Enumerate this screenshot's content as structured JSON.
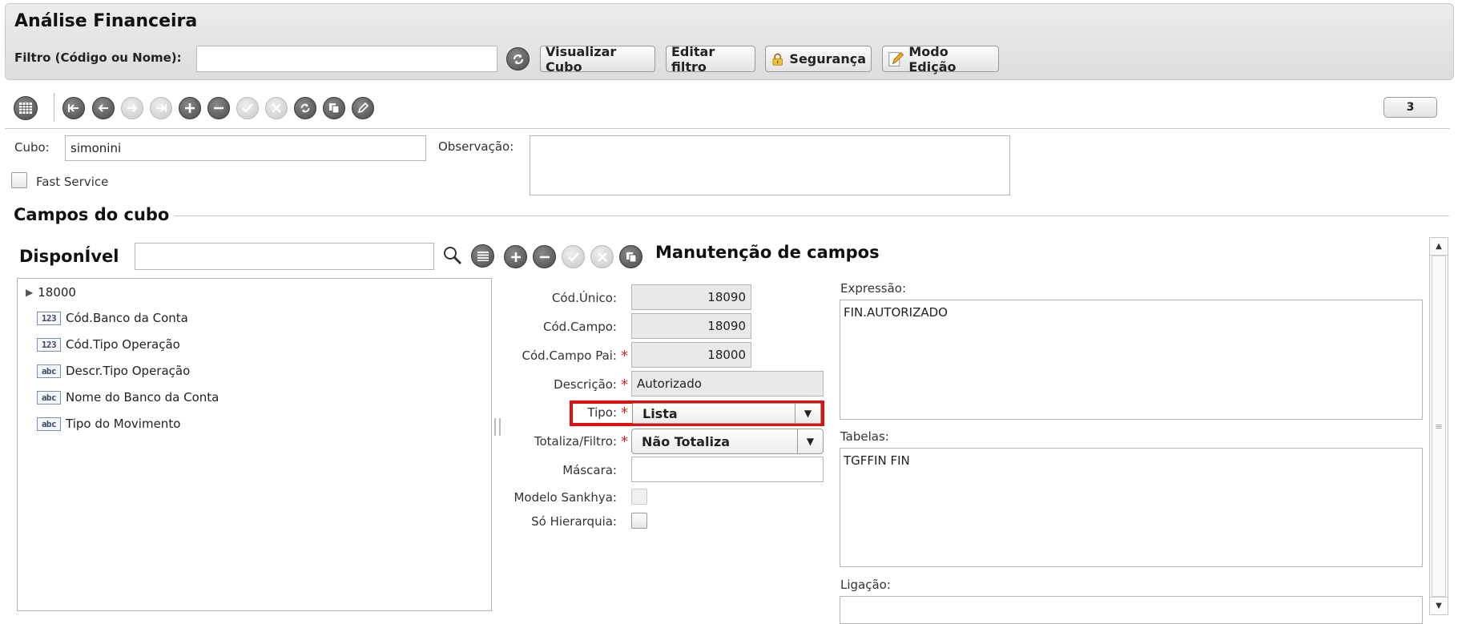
{
  "header": {
    "title": "Análise Financeira",
    "filter_label": "Filtro (Código ou Nome):",
    "filter_value": "",
    "buttons": {
      "visualizar": "Visualizar Cubo",
      "editar": "Editar filtro",
      "seguranca": "Segurança",
      "modo_edicao": "Modo Edição"
    }
  },
  "toolbar": {
    "record_count": "3"
  },
  "cube": {
    "cubo_label": "Cubo:",
    "cubo_value": "simonini",
    "observacao_label": "Observação:",
    "observacao_value": "",
    "fast_service_label": "Fast Service"
  },
  "campos": {
    "section_title": "Campos do cubo",
    "disponivel_label": "DisponÍvel",
    "search_value": "",
    "manutencao_title": "Manutenção de campos",
    "tree": {
      "root": "18000",
      "items": [
        {
          "type": "123",
          "label": "Cód.Banco da Conta"
        },
        {
          "type": "123",
          "label": "Cód.Tipo Operação"
        },
        {
          "type": "abc",
          "label": "Descr.Tipo Operação"
        },
        {
          "type": "abc",
          "label": "Nome do Banco da Conta"
        },
        {
          "type": "abc",
          "label": "Tipo do Movimento"
        }
      ]
    }
  },
  "form": {
    "cod_unico_label": "Cód.Único:",
    "cod_unico_value": "18090",
    "cod_campo_label": "Cód.Campo:",
    "cod_campo_value": "18090",
    "cod_campo_pai_label": "Cód.Campo Pai:",
    "cod_campo_pai_value": "18000",
    "descricao_label": "Descrição:",
    "descricao_value": "Autorizado",
    "tipo_label": "Tipo:",
    "tipo_value": "Lista",
    "totaliza_label": "Totaliza/Filtro:",
    "totaliza_value": "Não Totaliza",
    "mascara_label": "Máscara:",
    "mascara_value": "",
    "modelo_label": "Modelo Sankhya:",
    "hierarquia_label": "Só Hierarquia:",
    "required_mark": "*"
  },
  "right": {
    "expressao_label": "Expressão:",
    "expressao_value": "FIN.AUTORIZADO",
    "tabelas_label": "Tabelas:",
    "tabelas_value": "TGFFIN FIN",
    "ligacao_label": "Ligação:",
    "ligacao_value": ""
  },
  "colors": {
    "highlight": "#e01010",
    "required": "#d92020"
  }
}
